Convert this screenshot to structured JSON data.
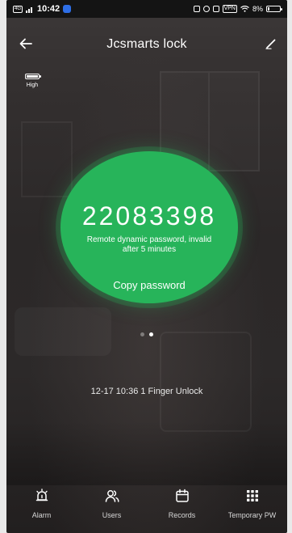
{
  "status_bar": {
    "signal_badge": "4G",
    "time": "10:42",
    "vpn": "VPN",
    "battery_text": "8%"
  },
  "header": {
    "title": "Jcsmarts lock",
    "back_icon": "arrow-left-icon",
    "edit_icon": "pencil-icon"
  },
  "lock_battery": {
    "label": "High",
    "level": 1.0
  },
  "password_panel": {
    "digits": "22083398",
    "note_line1": "Remote dynamic password, invalid",
    "note_line2": "after 5 minutes",
    "copy_label": "Copy password",
    "color": "#27b45a"
  },
  "pager": {
    "pages": 2,
    "active": 2
  },
  "last_record": {
    "text": "12-17 10:36  1 Finger Unlock"
  },
  "bottom_nav": {
    "items": [
      {
        "label": "Alarm",
        "icon": "alarm-bell-icon"
      },
      {
        "label": "Users",
        "icon": "users-icon"
      },
      {
        "label": "Records",
        "icon": "calendar-icon"
      },
      {
        "label": "Temporary PW",
        "icon": "keypad-grid-icon"
      }
    ]
  }
}
